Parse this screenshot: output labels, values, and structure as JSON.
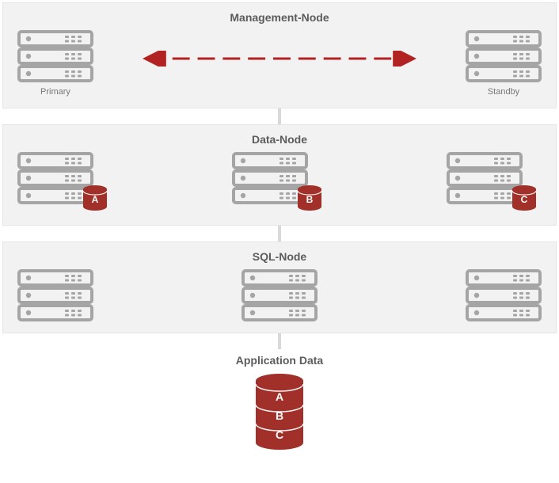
{
  "diagram": {
    "management_section": {
      "title": "Management-Node",
      "primary_label": "Primary",
      "standby_label": "Standby"
    },
    "data_section": {
      "title": "Data-Node",
      "badges": [
        "A",
        "B",
        "C"
      ]
    },
    "sql_section": {
      "title": "SQL-Node"
    },
    "application": {
      "title": "Application Data",
      "layers": [
        "A",
        "B",
        "C"
      ]
    },
    "colors": {
      "server": "#A5A5A5",
      "db": "#A12F2A",
      "arrow": "#B22222"
    }
  }
}
